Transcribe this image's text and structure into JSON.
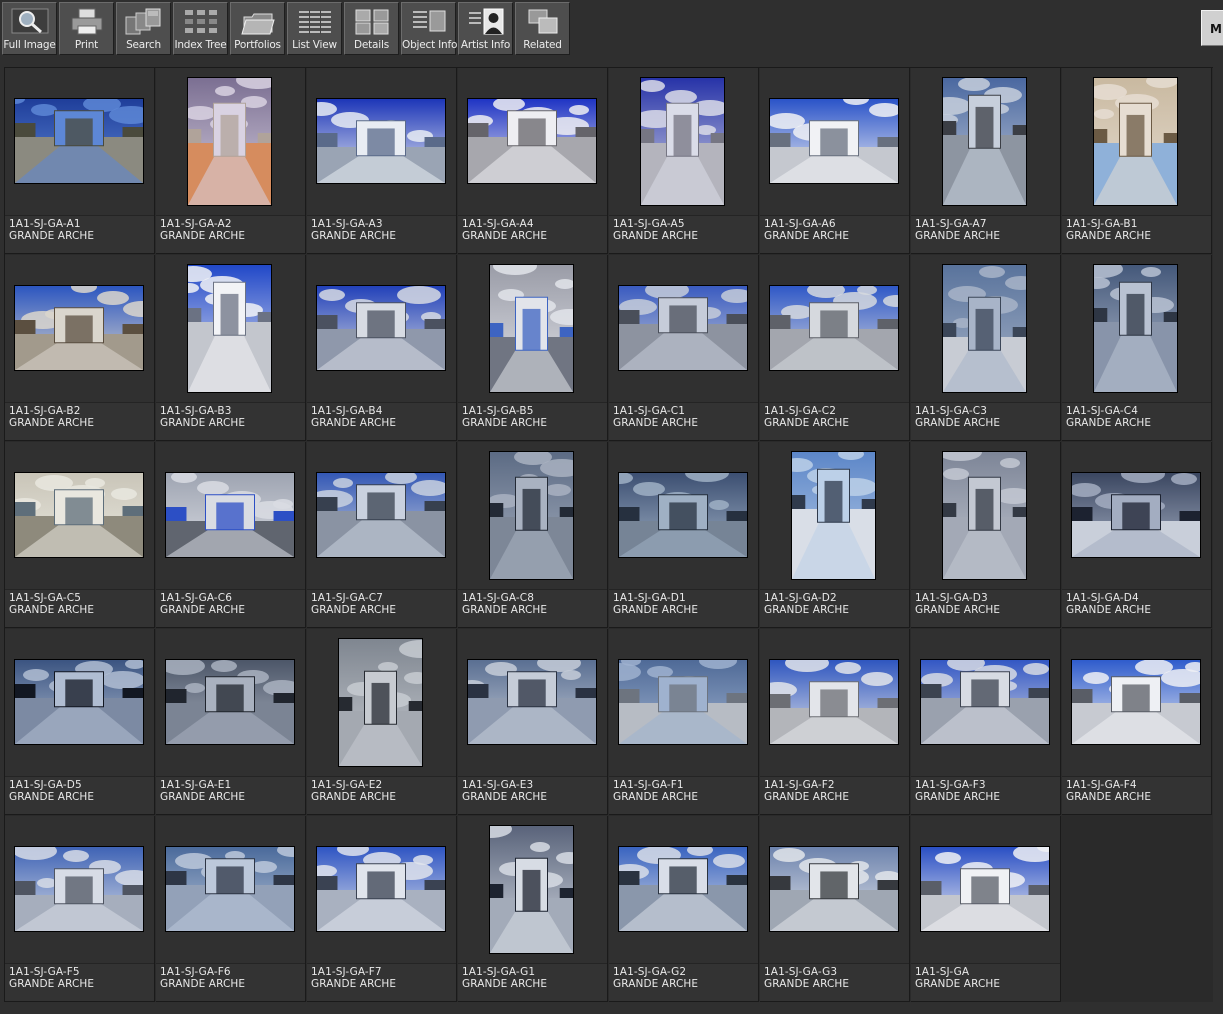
{
  "toolbar": {
    "buttons": [
      {
        "label": "Full Image",
        "icon": "magnifier-icon"
      },
      {
        "label": "Print",
        "icon": "printer-icon"
      },
      {
        "label": "Search",
        "icon": "search-stack-icon"
      },
      {
        "label": "Index Tree",
        "icon": "index-tree-icon"
      },
      {
        "label": "Portfolios",
        "icon": "folder-icon"
      },
      {
        "label": "List View",
        "icon": "list-view-icon"
      },
      {
        "label": "Details",
        "icon": "details-grid-icon"
      },
      {
        "label": "Object Info",
        "icon": "object-info-icon"
      },
      {
        "label": "Artist  Info",
        "icon": "artist-portrait-icon"
      },
      {
        "label": "Related",
        "icon": "related-images-icon"
      }
    ],
    "m_button": "M"
  },
  "thumbnails": [
    {
      "id": "1A1-SJ-GA-A1",
      "title": "GRANDE ARCHE",
      "orientation": "land",
      "palette": [
        "#1f3e9a",
        "#5d87d6",
        "#4a4a3c",
        "#8b8a80"
      ]
    },
    {
      "id": "1A1-SJ-GA-A2",
      "title": "GRANDE ARCHE",
      "orientation": "port",
      "palette": [
        "#7b6f92",
        "#d9d2e2",
        "#b0a39a",
        "#d68c5e"
      ]
    },
    {
      "id": "1A1-SJ-GA-A3",
      "title": "GRANDE ARCHE",
      "orientation": "land",
      "palette": [
        "#1d36b8",
        "#e8ecf3",
        "#5a6a8a",
        "#9aa4b4"
      ]
    },
    {
      "id": "1A1-SJ-GA-A4",
      "title": "GRANDE ARCHE",
      "orientation": "land",
      "palette": [
        "#1f34c4",
        "#eeeef2",
        "#65646a",
        "#a7a7ad"
      ]
    },
    {
      "id": "1A1-SJ-GA-A5",
      "title": "GRANDE ARCHE",
      "orientation": "port",
      "palette": [
        "#2733a8",
        "#dadce8",
        "#767683",
        "#b4b4bd"
      ]
    },
    {
      "id": "1A1-SJ-GA-A6",
      "title": "GRANDE ARCHE",
      "orientation": "land",
      "palette": [
        "#2a53c8",
        "#f1f2f5",
        "#68707f",
        "#c5c8cf"
      ]
    },
    {
      "id": "1A1-SJ-GA-A7",
      "title": "GRANDE ARCHE",
      "orientation": "port",
      "palette": [
        "#4a68a0",
        "#c7cfdc",
        "#3b3e45",
        "#8d95a1"
      ]
    },
    {
      "id": "1A1-SJ-GA-B1",
      "title": "GRANDE ARCHE",
      "orientation": "port",
      "palette": [
        "#c9b9a0",
        "#e6ddd2",
        "#6b5a44",
        "#8fb1d9"
      ]
    },
    {
      "id": "1A1-SJ-GA-B2",
      "title": "GRANDE ARCHE",
      "orientation": "land",
      "palette": [
        "#2c56c0",
        "#dad6cd",
        "#5b4f40",
        "#a29a8c"
      ]
    },
    {
      "id": "1A1-SJ-GA-B3",
      "title": "GRANDE ARCHE",
      "orientation": "port",
      "palette": [
        "#2148c8",
        "#f2f3f6",
        "#6b7283",
        "#c3c6cd"
      ]
    },
    {
      "id": "1A1-SJ-GA-B4",
      "title": "GRANDE ARCHE",
      "orientation": "land",
      "palette": [
        "#2241b9",
        "#d7dbe3",
        "#4b5160",
        "#8f98ab"
      ]
    },
    {
      "id": "1A1-SJ-GA-B5",
      "title": "GRANDE ARCHE",
      "orientation": "port",
      "palette": [
        "#9a9ca7",
        "#e2e4ea",
        "#3d64c2",
        "#707582"
      ]
    },
    {
      "id": "1A1-SJ-GA-C1",
      "title": "GRANDE ARCHE",
      "orientation": "land",
      "palette": [
        "#3a5bc0",
        "#c6ccd9",
        "#4a4f5a",
        "#8d93a0"
      ]
    },
    {
      "id": "1A1-SJ-GA-C2",
      "title": "GRANDE ARCHE",
      "orientation": "land",
      "palette": [
        "#2f58c7",
        "#d6d9de",
        "#5e6169",
        "#a3a6ae"
      ]
    },
    {
      "id": "1A1-SJ-GA-C3",
      "title": "GRANDE ARCHE",
      "orientation": "port",
      "palette": [
        "#59739c",
        "#a8b4c8",
        "#3b4658",
        "#c8ccd4"
      ]
    },
    {
      "id": "1A1-SJ-GA-C4",
      "title": "GRANDE ARCHE",
      "orientation": "port",
      "palette": [
        "#44587a",
        "#b9c2d2",
        "#2e3644",
        "#8894aa"
      ]
    },
    {
      "id": "1A1-SJ-GA-C5",
      "title": "GRANDE ARCHE",
      "orientation": "land",
      "palette": [
        "#c9c5b8",
        "#e9e7df",
        "#5e6e7a",
        "#8e8a7c"
      ]
    },
    {
      "id": "1A1-SJ-GA-C6",
      "title": "GRANDE ARCHE",
      "orientation": "land",
      "palette": [
        "#9ea4b1",
        "#d9dce3",
        "#2c4fc5",
        "#60656f"
      ]
    },
    {
      "id": "1A1-SJ-GA-C7",
      "title": "GRANDE ARCHE",
      "orientation": "land",
      "palette": [
        "#3458b5",
        "#c9d1df",
        "#37404f",
        "#8a93a3"
      ]
    },
    {
      "id": "1A1-SJ-GA-C8",
      "title": "GRANDE ARCHE",
      "orientation": "port",
      "palette": [
        "#5c6b84",
        "#a9b2c1",
        "#232a36",
        "#7d8797"
      ]
    },
    {
      "id": "1A1-SJ-GA-D1",
      "title": "GRANDE ARCHE",
      "orientation": "land",
      "palette": [
        "#3c4f72",
        "#9fb0c4",
        "#26303f",
        "#768496"
      ]
    },
    {
      "id": "1A1-SJ-GA-D2",
      "title": "GRANDE ARCHE",
      "orientation": "port",
      "palette": [
        "#5c86c8",
        "#bcd0e8",
        "#2f3a4c",
        "#d9dee7"
      ]
    },
    {
      "id": "1A1-SJ-GA-D3",
      "title": "GRANDE ARCHE",
      "orientation": "port",
      "palette": [
        "#7d8597",
        "#c3c8d2",
        "#333944",
        "#a3a9b6"
      ]
    },
    {
      "id": "1A1-SJ-GA-D4",
      "title": "GRANDE ARCHE",
      "orientation": "land",
      "palette": [
        "#3a4660",
        "#a3adc1",
        "#1c2230",
        "#c9cfda"
      ]
    },
    {
      "id": "1A1-SJ-GA-D5",
      "title": "GRANDE ARCHE",
      "orientation": "land",
      "palette": [
        "#3b5481",
        "#b0bdd2",
        "#121722",
        "#7c8aa3"
      ]
    },
    {
      "id": "1A1-SJ-GA-E1",
      "title": "GRANDE ARCHE",
      "orientation": "land",
      "palette": [
        "#4c5668",
        "#a9b1bf",
        "#20252e",
        "#7b8494"
      ]
    },
    {
      "id": "1A1-SJ-GA-E2",
      "title": "GRANDE ARCHE",
      "orientation": "port",
      "palette": [
        "#7f8690",
        "#c7cbd1",
        "#262a31",
        "#a4a9b1"
      ]
    },
    {
      "id": "1A1-SJ-GA-E3",
      "title": "GRANDE ARCHE",
      "orientation": "land",
      "palette": [
        "#5a6f92",
        "#c5ccd8",
        "#2a3242",
        "#8f9bb0"
      ]
    },
    {
      "id": "1A1-SJ-GA-F1",
      "title": "GRANDE ARCHE",
      "orientation": "land",
      "palette": [
        "#4f6a97",
        "#9fb2cf",
        "#6d747f",
        "#b7bcc4"
      ]
    },
    {
      "id": "1A1-SJ-GA-F2",
      "title": "GRANDE ARCHE",
      "orientation": "land",
      "palette": [
        "#2f56bf",
        "#e3e5ea",
        "#6c6e74",
        "#b3b5ba"
      ]
    },
    {
      "id": "1A1-SJ-GA-F3",
      "title": "GRANDE ARCHE",
      "orientation": "land",
      "palette": [
        "#3357c4",
        "#d7dbe3",
        "#3c4350",
        "#9aa1ae"
      ]
    },
    {
      "id": "1A1-SJ-GA-F4",
      "title": "GRANDE ARCHE",
      "orientation": "land",
      "palette": [
        "#2f5ccc",
        "#eef0f4",
        "#595d66",
        "#c7cad1"
      ]
    },
    {
      "id": "1A1-SJ-GA-F5",
      "title": "GRANDE ARCHE",
      "orientation": "land",
      "palette": [
        "#3f63b5",
        "#d7dce6",
        "#4f5562",
        "#a6aebd"
      ]
    },
    {
      "id": "1A1-SJ-GA-F6",
      "title": "GRANDE ARCHE",
      "orientation": "land",
      "palette": [
        "#4a6a9b",
        "#bcc8da",
        "#2e3646",
        "#93a1b8"
      ]
    },
    {
      "id": "1A1-SJ-GA-F7",
      "title": "GRANDE ARCHE",
      "orientation": "land",
      "palette": [
        "#2f55c3",
        "#e0e4ec",
        "#3a4252",
        "#a9b1c0"
      ]
    },
    {
      "id": "1A1-SJ-GA-G1",
      "title": "GRANDE ARCHE",
      "orientation": "port",
      "palette": [
        "#59637a",
        "#d7dce4",
        "#1d2330",
        "#a3abb9"
      ]
    },
    {
      "id": "1A1-SJ-GA-G2",
      "title": "GRANDE ARCHE",
      "orientation": "land",
      "palette": [
        "#3a64c0",
        "#d9dee8",
        "#2a3340",
        "#8a97ab"
      ]
    },
    {
      "id": "1A1-SJ-GA-G3",
      "title": "GRANDE ARCHE",
      "orientation": "land",
      "palette": [
        "#6d83ad",
        "#e2e5ea",
        "#36393e",
        "#9fa7b3"
      ]
    },
    {
      "id": "1A1-SJ-GA",
      "title": "GRANDE ARCHE",
      "orientation": "land",
      "palette": [
        "#2a4fc4",
        "#f0f1f4",
        "#5a5e68",
        "#c3c6cd"
      ]
    }
  ]
}
